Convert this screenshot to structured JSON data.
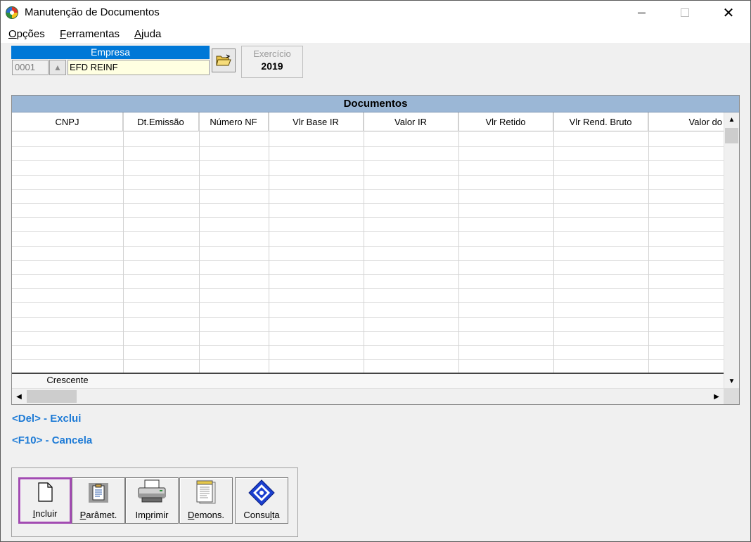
{
  "window": {
    "title": "Manutenção de Documentos"
  },
  "menu": [
    {
      "label": "Opções",
      "accel": "O",
      "rest": "pções"
    },
    {
      "label": "Ferramentas",
      "accel": "F",
      "rest": "erramentas"
    },
    {
      "label": "Ajuda",
      "accel": "A",
      "rest": "juda"
    }
  ],
  "empresa": {
    "header": "Empresa",
    "code": "0001",
    "name": "EFD REINF"
  },
  "exercicio": {
    "label": "Exercício",
    "value": "2019"
  },
  "grid": {
    "title": "Documentos",
    "columns": [
      "CNPJ",
      "Dt.Emissão",
      "Número NF",
      "Vlr Base IR",
      "Valor IR",
      "Vlr Retido",
      "Vlr Rend. Bruto",
      "Valor do"
    ],
    "footer_label": "Crescente",
    "empty_rows": 17
  },
  "hints": {
    "del": "<Del> - Exclui",
    "f10": "<F10> - Cancela"
  },
  "toolbar": {
    "incluir": {
      "label": "Incluir",
      "accel": "I",
      "rest": "ncluir"
    },
    "paramet": {
      "label": "Parâmet.",
      "accel": "P",
      "rest": "arâmet."
    },
    "imprimir": {
      "label": "Imprimir",
      "pre": "Im",
      "accel": "p",
      "rest": "rimir"
    },
    "demons": {
      "label": "Demons.",
      "accel": "D",
      "rest": "emons."
    },
    "consulta": {
      "label": "Consulta",
      "pre": "Consu",
      "accel": "l",
      "rest": "ta"
    }
  },
  "colors": {
    "empresa_header": "#0078d7",
    "grid_title": "#9bb7d6",
    "hint_text": "#1e7bd6",
    "active_button_border": "#a24bb2"
  },
  "icons": {
    "app": "app-logo-icon",
    "folder": "open-folder-icon",
    "incluir": "new-document-icon",
    "paramet": "clipboard-icon",
    "imprimir": "printer-icon",
    "demons": "report-icon",
    "consulta": "consult-diamond-icon"
  }
}
